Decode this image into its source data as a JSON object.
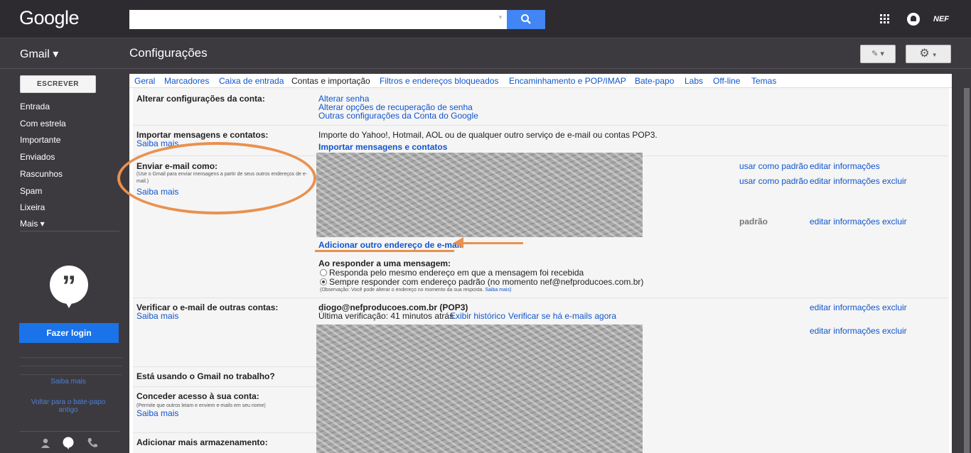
{
  "header": {
    "logo": "Google",
    "search": {
      "value": "",
      "placeholder": ""
    },
    "avatar_text": "NEF"
  },
  "subbar": {
    "app_menu": "Gmail ▾",
    "title": "Configurações"
  },
  "sidebar": {
    "compose": "ESCREVER",
    "items": [
      "Entrada",
      "Com estrela",
      "Importante",
      "Enviados",
      "Rascunhos",
      "Spam",
      "Lixeira",
      "Mais ▾"
    ],
    "hangouts_login": "Fazer login",
    "saiba_mais": "Saiba mais",
    "old_chat": "Voltar para o bate-papo antigo"
  },
  "tabs": [
    "Geral",
    "Marcadores",
    "Caixa de entrada",
    "Contas e importação",
    "Filtros e endereços bloqueados",
    "Encaminhamento e POP/IMAP",
    "Bate-papo",
    "Labs",
    "Off-line",
    "Temas"
  ],
  "settings": {
    "account": {
      "label": "Alterar configurações da conta:",
      "links": [
        "Alterar senha",
        "Alterar opções de recuperação de senha",
        "Outras configurações da Conta do Google"
      ]
    },
    "import": {
      "label": "Importar mensagens e contatos:",
      "learn": "Saiba mais",
      "desc": "Importe do Yahoo!, Hotmail, AOL ou de qualquer outro serviço de e-mail ou contas POP3.",
      "action": "Importar mensagens e contatos"
    },
    "send_as": {
      "label": "Enviar e-mail como:",
      "note": "(Use o Gmail para enviar mensagens a partir de seus outros endereços de e-mail.)",
      "learn": "Saiba mais",
      "use_default": "usar como padrão",
      "edit": "editar informações",
      "delete": "excluir",
      "default": "padrão",
      "add": "Adicionar outro endereço de e-mail",
      "reply_title": "Ao responder a uma mensagem:",
      "reply_opt1": "Responda pelo mesmo endereço em que a mensagem foi recebida",
      "reply_opt2": "Sempre responder com endereço padrão (no momento nef@nefproducoes.com.br)",
      "reply_note": "(Observação: Você pode alterar o endereço no momento da sua resposta.",
      "reply_note_link": "Saiba mais)"
    },
    "check_mail": {
      "label": "Verificar o e-mail de outras contas:",
      "learn": "Saiba mais",
      "account": "diogo@nefproducoes.com.br (POP3)",
      "last_check": "Última verificação: 41 minutos atrás.",
      "history": "Exibir histórico",
      "check_now": "Verificar se há e-mails agora",
      "edit": "editar informações",
      "delete": "excluir"
    },
    "work": {
      "label": "Está usando o Gmail no trabalho?"
    },
    "grant": {
      "label": "Conceder acesso à sua conta:",
      "note": "(Permite que outros leiam e enviem e-mails em seu nome)",
      "learn": "Saiba mais"
    },
    "storage": {
      "label": "Adicionar mais armazenamento:"
    }
  },
  "colors": {
    "accent": "#e9914f",
    "link": "#1155cc",
    "primary": "#4285f4"
  }
}
